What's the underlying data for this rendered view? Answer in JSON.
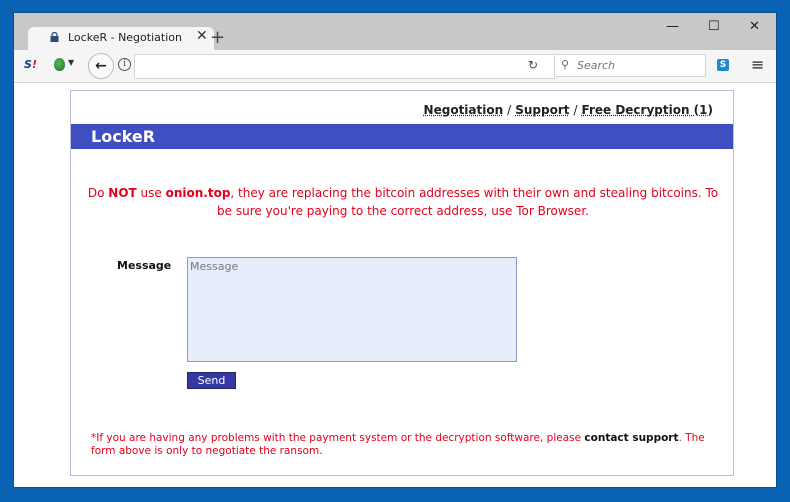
{
  "browser": {
    "tab_title": "LockeR - Negotiation",
    "tab_close_glyph": "✕",
    "new_tab_glyph": "+",
    "window_controls": {
      "minimize": "—",
      "maximize": "☐",
      "close": "✕"
    },
    "toolbar": {
      "addon_s_label": "S",
      "addon_s_mark": "!",
      "back_glyph": "🡐",
      "info_glyph": "i",
      "url_value": "",
      "reload_glyph": "↻",
      "search_icon": "⚲",
      "search_placeholder": "Search",
      "skype_label": "S",
      "menu_glyph": "≡"
    }
  },
  "page": {
    "nav": {
      "items": [
        "Negotiation",
        "Support",
        "Free Decryption (1)"
      ],
      "separator": "/"
    },
    "brand": "LockeR",
    "warning": {
      "prefix": "Do ",
      "bold1": "NOT",
      "mid1": " use ",
      "bold2": "onion.top",
      "rest": ", they are replacing the bitcoin addresses with their own and stealing bitcoins. To be sure you're paying to the correct address, use Tor Browser."
    },
    "form": {
      "message_label": "Message",
      "message_placeholder": "Message",
      "message_value": "",
      "send_label": "Send"
    },
    "footnote": {
      "prefix": "*If you are having any problems with the payment system or the decryption software, please ",
      "link": "contact support",
      "suffix": ". The form above is only to negotiate the ransom."
    }
  },
  "colors": {
    "banner": "#3f4ec0",
    "warning_text": "#e3001b",
    "send_button": "#3638a6",
    "textarea_bg": "#e6eefb",
    "desktop": "#0a62b5"
  }
}
